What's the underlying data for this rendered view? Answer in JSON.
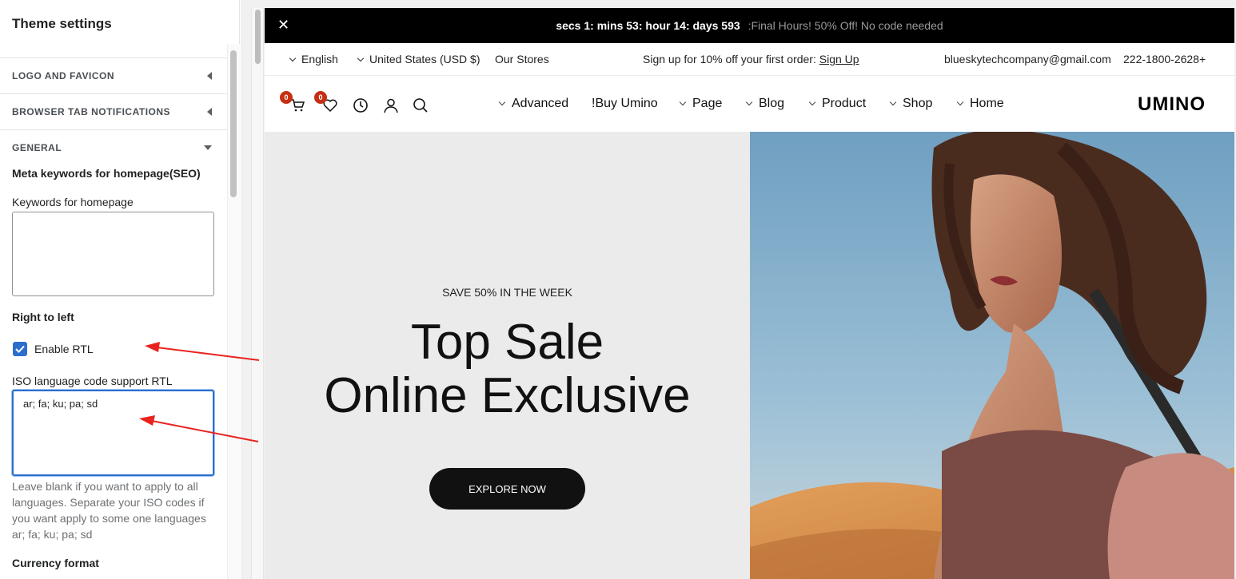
{
  "panel": {
    "title": "Theme settings",
    "sections": [
      {
        "label": "LOGO AND FAVICON",
        "state": "collapsed"
      },
      {
        "label": "BROWSER TAB NOTIFICATIONS",
        "state": "collapsed"
      },
      {
        "label": "GENERAL",
        "state": "expanded"
      }
    ],
    "meta_heading": "Meta keywords for homepage(SEO)",
    "keywords_label": "Keywords for homepage",
    "keywords_value": "",
    "rtl_heading": "Right to left",
    "rtl_checkbox_label": "Enable RTL",
    "rtl_checked": true,
    "iso_label": "ISO language code support RTL",
    "iso_value": "ar; fa; ku; pa; sd",
    "iso_help": "Leave blank if you want to apply to all languages. Separate your ISO codes if you want apply to some one languages ar; fa; ku; pa; sd",
    "currency_heading": "Currency format"
  },
  "site": {
    "announcement": {
      "close_icon": "close-icon",
      "timer_text": "secs 1: mins 53: hour 14: days 593",
      "offer_text": ":Final Hours! 50% Off! No code needed"
    },
    "topbar": {
      "language": "English",
      "country": "United States (USD $)",
      "stores": "Our Stores",
      "signup_text": "Sign up for 10% off your first order:",
      "signup_link": "Sign Up",
      "email": "blueskytechcompany@gmail.com",
      "phone": "222-1800-2628+"
    },
    "nav": {
      "cart_count": "0",
      "wishlist_count": "0",
      "menu": [
        "Advanced",
        "!Buy Umino",
        "Page",
        "Blog",
        "Product",
        "Shop",
        "Home"
      ],
      "logo": "UMINO"
    },
    "hero": {
      "subtitle": "SAVE 50% IN THE WEEK",
      "title_line1": "Top Sale",
      "title_line2": "Online Exclusive",
      "cta": "EXPLORE NOW"
    }
  },
  "colors": {
    "accent_blue": "#2c6ecb",
    "badge_red": "#c62f13",
    "annotation_red": "#e8231f",
    "hero_bg": "#ebebeb"
  }
}
